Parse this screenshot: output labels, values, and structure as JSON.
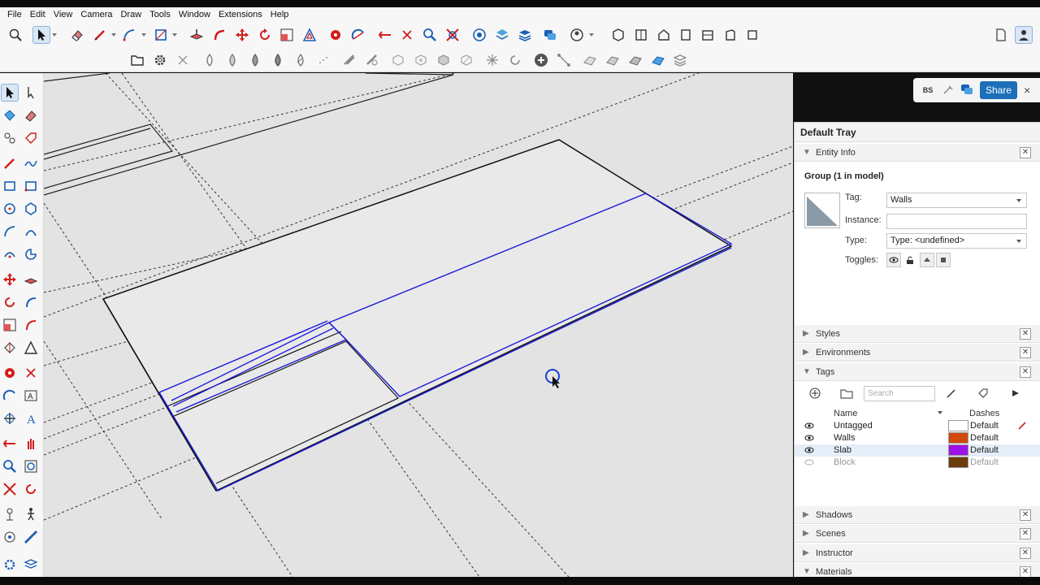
{
  "menu": [
    "File",
    "Edit",
    "View",
    "Camera",
    "Draw",
    "Tools",
    "Window",
    "Extensions",
    "Help"
  ],
  "toolbar_icons": [
    "search-icon",
    "select-icon",
    "eraser-icon",
    "pencil-icon",
    "line-icon",
    "arc-icon",
    "push-pull-icon",
    "follow-me-icon",
    "move-icon",
    "rotate-icon",
    "scale-icon",
    "tape-measure-icon",
    "protractor-icon",
    "text-icon",
    "orbit-icon",
    "pan-icon",
    "zoom-icon",
    "zoom-extents-icon",
    "section-icon",
    "warehouse-icon",
    "extension-icon",
    "component-icon",
    "new-file-icon",
    "user-icon"
  ],
  "collab": {
    "initials": "BS",
    "share_label": "Share",
    "close": "×"
  },
  "tray": {
    "title": "Default Tray",
    "entity_info": {
      "header": "Entity Info",
      "group_label": "Group (1 in model)",
      "tag_label": "Tag:",
      "tag_value": "Walls",
      "instance_label": "Instance:",
      "instance_value": "",
      "type_label": "Type:",
      "type_value": "Type: <undefined>",
      "toggles_label": "Toggles:"
    },
    "sections": {
      "styles": "Styles",
      "environments": "Environments",
      "tags": "Tags",
      "shadows": "Shadows",
      "scenes": "Scenes",
      "instructor": "Instructor",
      "materials": "Materials"
    },
    "tags_panel": {
      "search_placeholder": "Search",
      "col_name": "Name",
      "col_dashes": "Dashes",
      "rows": [
        {
          "name": "Untagged",
          "dashes": "Default",
          "color": "#ffffff",
          "visible": true
        },
        {
          "name": "Walls",
          "dashes": "Default",
          "color": "#d24a0a",
          "visible": true
        },
        {
          "name": "Slab",
          "dashes": "Default",
          "color": "#9b12e6",
          "visible": true
        },
        {
          "name": "Block",
          "dashes": "Default",
          "color": "#6b3c0c",
          "visible": false
        }
      ]
    }
  },
  "colors": {
    "selection_blue": "#1a1ad8",
    "share_blue": "#1c6fb8",
    "viewport_bg": "#e3e3e3"
  }
}
